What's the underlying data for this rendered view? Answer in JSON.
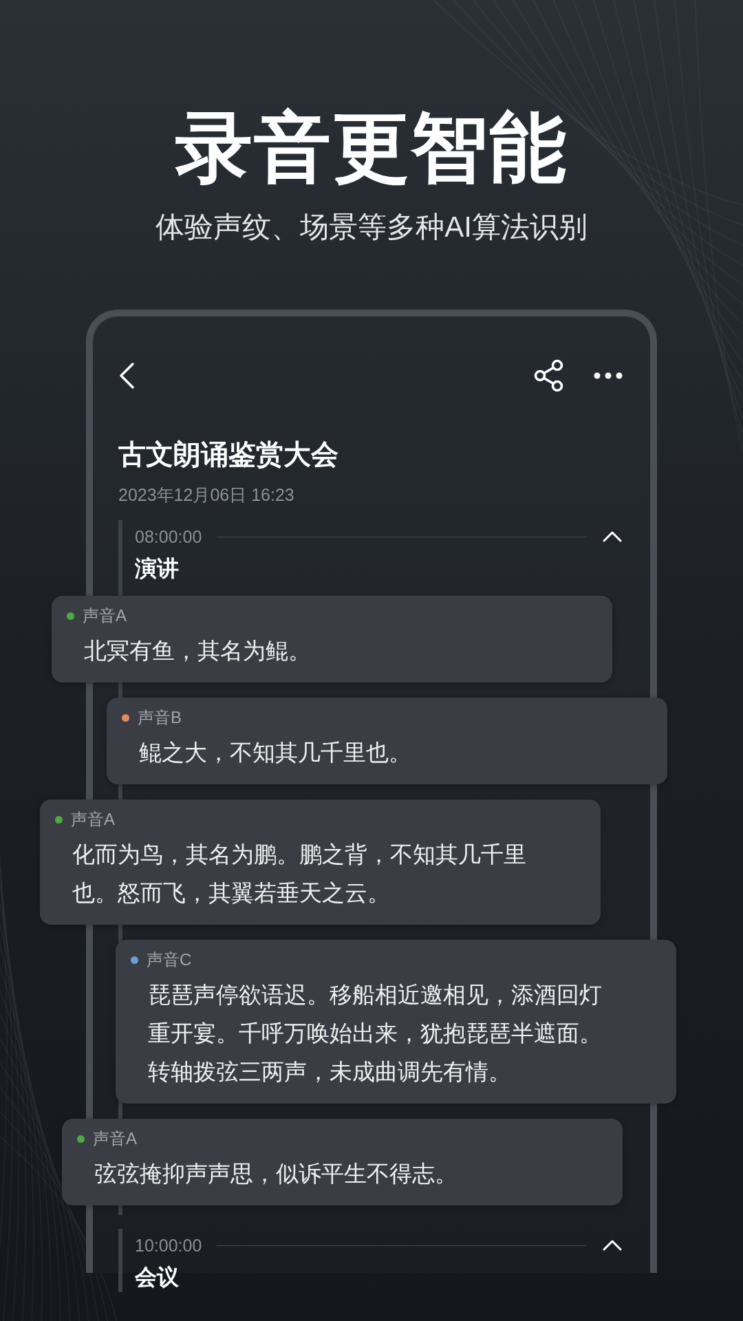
{
  "headline": "录音更智能",
  "subtitle": "体验声纹、场景等多种AI算法识别",
  "recording": {
    "title": "古文朗诵鉴赏大会",
    "datetime": "2023年12月06日 16:23"
  },
  "sections": [
    {
      "time": "08:00:00",
      "label": "演讲",
      "expanded": true,
      "utterances": [
        {
          "speaker": "声音A",
          "color": "#4fa843",
          "text": "北冥有鱼，其名为鲲。"
        },
        {
          "speaker": "声音B",
          "color": "#e28a5e",
          "text": "鲲之大，不知其几千里也。"
        },
        {
          "speaker": "声音A",
          "color": "#4fa843",
          "text": "化而为鸟，其名为鹏。鹏之背，不知其几千里也。怒而飞，其翼若垂天之云。"
        },
        {
          "speaker": "声音C",
          "color": "#6e9ed6",
          "text": "琵琶声停欲语迟。移船相近邀相见，添酒回灯重开宴。千呼万唤始出来，犹抱琵琶半遮面。转轴拨弦三两声，未成曲调先有情。"
        },
        {
          "speaker": "声音A",
          "color": "#4fa843",
          "text": "弦弦掩抑声声思，似诉平生不得志。"
        }
      ]
    },
    {
      "time": "10:00:00",
      "label": "会议",
      "expanded": true
    }
  ]
}
